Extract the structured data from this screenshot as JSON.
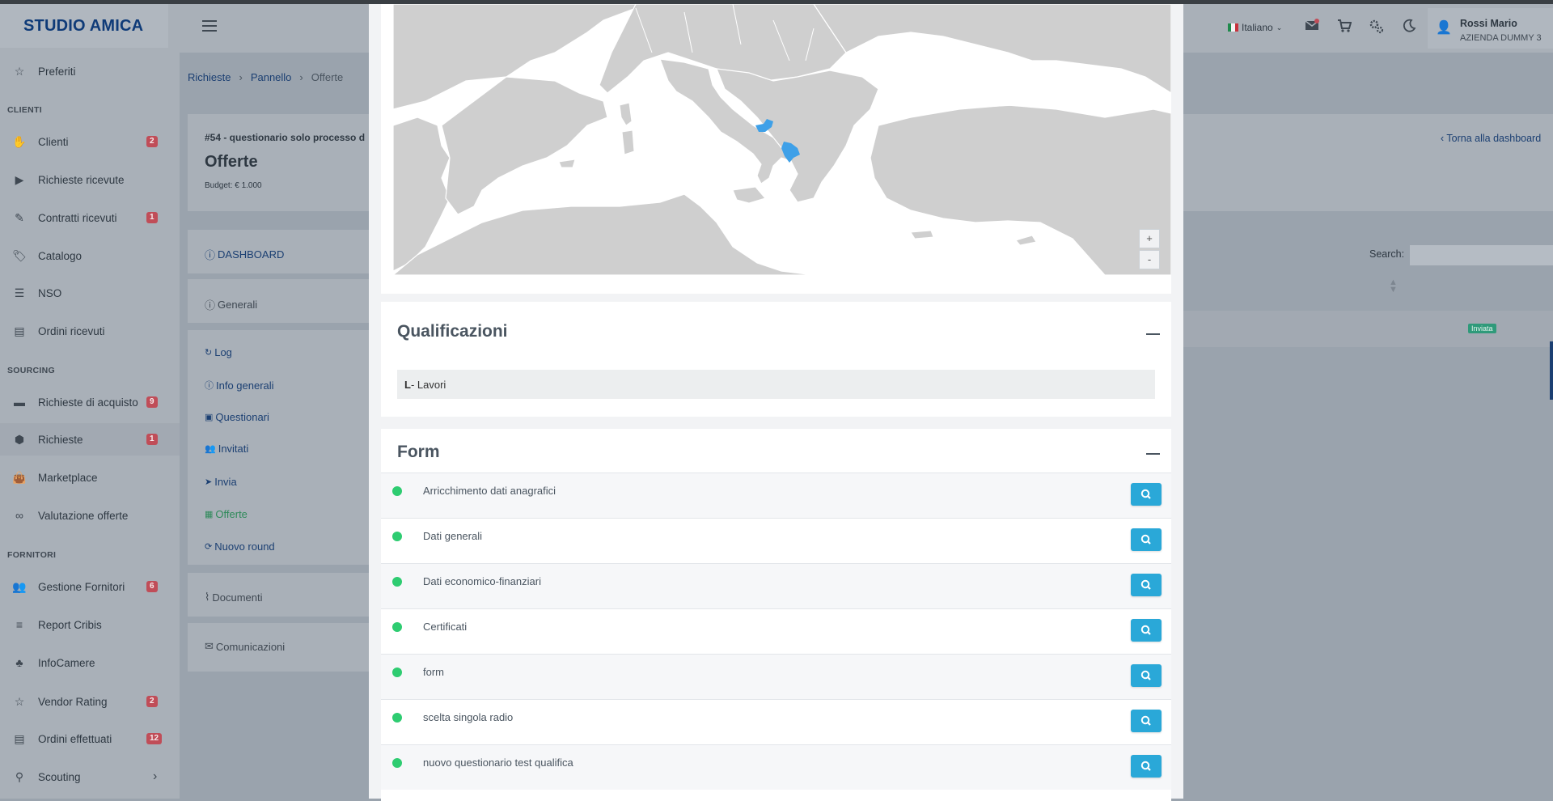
{
  "app": {
    "logo": "STUDIO AMICA"
  },
  "sidebar": {
    "items": [
      {
        "label": "Preferiti",
        "icon": "star-icon",
        "glyph": "☆"
      },
      {
        "section": "CLIENTI"
      },
      {
        "label": "Clienti",
        "icon": "handshake-icon",
        "glyph": "✋",
        "badge": "2"
      },
      {
        "label": "Richieste ricevute",
        "icon": "play-circle-icon",
        "glyph": "▶"
      },
      {
        "label": "Contratti ricevuti",
        "icon": "contract-edit-icon",
        "glyph": "✎",
        "badge": "1"
      },
      {
        "label": "Catalogo",
        "icon": "tags-icon",
        "glyph": "🏷"
      },
      {
        "label": "NSO",
        "icon": "list-box-icon",
        "glyph": "☰"
      },
      {
        "label": "Ordini ricevuti",
        "icon": "receipt-icon",
        "glyph": "▤"
      },
      {
        "section": "SOURCING"
      },
      {
        "label": "Richieste di acquisto",
        "icon": "card-icon",
        "glyph": "▬",
        "badge": "9"
      },
      {
        "label": "Richieste",
        "icon": "box-icon",
        "glyph": "⬢",
        "badge": "1",
        "active": true
      },
      {
        "label": "Marketplace",
        "icon": "shopping-bag-icon",
        "glyph": "👜"
      },
      {
        "label": "Valutazione offerte",
        "icon": "glasses-icon",
        "glyph": "∞"
      },
      {
        "section": "FORNITORI"
      },
      {
        "label": "Gestione Fornitori",
        "icon": "users-icon",
        "glyph": "👥",
        "badge": "6"
      },
      {
        "label": "Report Cribis",
        "icon": "cribis-icon",
        "glyph": "≡"
      },
      {
        "label": "InfoCamere",
        "icon": "tree-icon",
        "glyph": "♣"
      },
      {
        "label": "Vendor Rating",
        "icon": "star-outline-icon",
        "glyph": "☆",
        "badge": "2"
      },
      {
        "label": "Ordini effettuati",
        "icon": "orders-icon",
        "glyph": "▤",
        "badge": "12"
      },
      {
        "label": "Scouting",
        "icon": "search-icon",
        "glyph": "⚲",
        "chevron": "›"
      }
    ]
  },
  "header": {
    "language": "Italiano",
    "user_name": "Rossi Mario",
    "user_company": "AZIENDA DUMMY 3",
    "icons": [
      "mail-icon",
      "cart-icon",
      "settings-icon",
      "moon-icon"
    ]
  },
  "breadcrumb": [
    "Richieste",
    "Pannello",
    "Offerte"
  ],
  "page": {
    "subtitle": "#54 - questionario solo processo d",
    "title": "Offerte",
    "budget": "Budget: € 1.000",
    "back_link": "Torna alla dashboard"
  },
  "left_nav": {
    "dashboard": "DASHBOARD",
    "generali": "Generali",
    "items": [
      "Log",
      "Info generali",
      "Questionari",
      "Invitati",
      "Invia",
      "Offerte",
      "Nuovo round"
    ],
    "documenti": "Documenti",
    "comunicazioni": "Comunicazioni"
  },
  "table": {
    "search_label": "Search:",
    "status_badge": "Inviata"
  },
  "modal": {
    "map_zoom_in": "+",
    "map_zoom_out": "-",
    "qualificazioni": {
      "title": "Qualificazioni",
      "code": "L",
      "rest": " - Lavori"
    },
    "form": {
      "title": "Form",
      "rows": [
        "Arricchimento dati anagrafici",
        "Dati generali",
        "Dati economico-finanziari",
        "Certificati",
        "form",
        "scelta singola radio",
        "nuovo questionario test qualifica"
      ]
    }
  },
  "colors": {
    "accent": "#2aa8d8",
    "status_green": "#2ecc71",
    "highlight_region": "#3ea0e8"
  }
}
